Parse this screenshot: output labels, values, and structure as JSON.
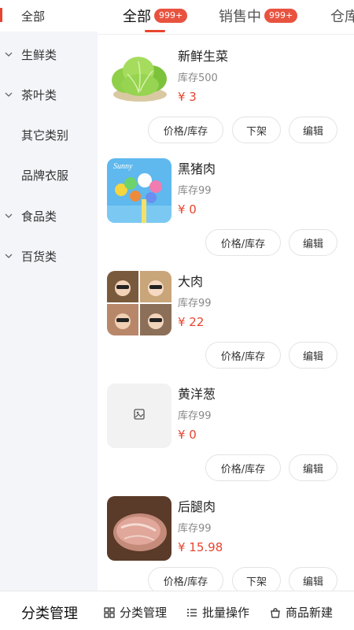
{
  "sidebar": {
    "items": [
      {
        "label": "全部",
        "active": true,
        "has_chevron": false
      },
      {
        "label": "生鲜类",
        "active": false,
        "has_chevron": true
      },
      {
        "label": "茶叶类",
        "active": false,
        "has_chevron": true
      },
      {
        "label": "其它类别",
        "active": false,
        "has_chevron": false
      },
      {
        "label": "品牌衣服",
        "active": false,
        "has_chevron": false
      },
      {
        "label": "食品类",
        "active": false,
        "has_chevron": true
      },
      {
        "label": "百货类",
        "active": false,
        "has_chevron": true
      }
    ]
  },
  "tabs": [
    {
      "label": "全部",
      "badge": "999+",
      "active": true
    },
    {
      "label": "销售中",
      "badge": "999+",
      "active": false
    },
    {
      "label": "仓库",
      "badge": "",
      "active": false
    }
  ],
  "products": [
    {
      "name": "新鲜生菜",
      "stock": "库存500",
      "price": "¥ 3",
      "thumb": "lettuce-image",
      "buttons": [
        "价格/库存",
        "下架",
        "编辑"
      ]
    },
    {
      "name": "黑猪肉",
      "stock": "库存99",
      "price": "¥ 0",
      "thumb": "balloons-image",
      "thumb_text": "Sunny",
      "buttons": [
        "价格/库存",
        "编辑"
      ]
    },
    {
      "name": "大肉",
      "stock": "库存99",
      "price": "¥ 22",
      "thumb": "photo-collage-image",
      "buttons": [
        "价格/库存",
        "编辑"
      ]
    },
    {
      "name": "黄洋葱",
      "stock": "库存99",
      "price": "¥ 0",
      "thumb": "image-placeholder-icon",
      "buttons": [
        "价格/库存",
        "编辑"
      ]
    },
    {
      "name": "后腿肉",
      "stock": "库存99",
      "price": "¥ 15.98",
      "thumb": "pork-image",
      "buttons": [
        "价格/库存",
        "下架",
        "编辑"
      ]
    }
  ],
  "bottom_bar": {
    "title": "分类管理",
    "actions": [
      {
        "label": "分类管理",
        "icon": "grid-icon"
      },
      {
        "label": "批量操作",
        "icon": "list-icon"
      },
      {
        "label": "商品新建",
        "icon": "bag-icon"
      }
    ]
  },
  "colors": {
    "accent": "#e8452f",
    "badge": "#e8533f",
    "sidebar_bg": "#f4f5f9"
  }
}
